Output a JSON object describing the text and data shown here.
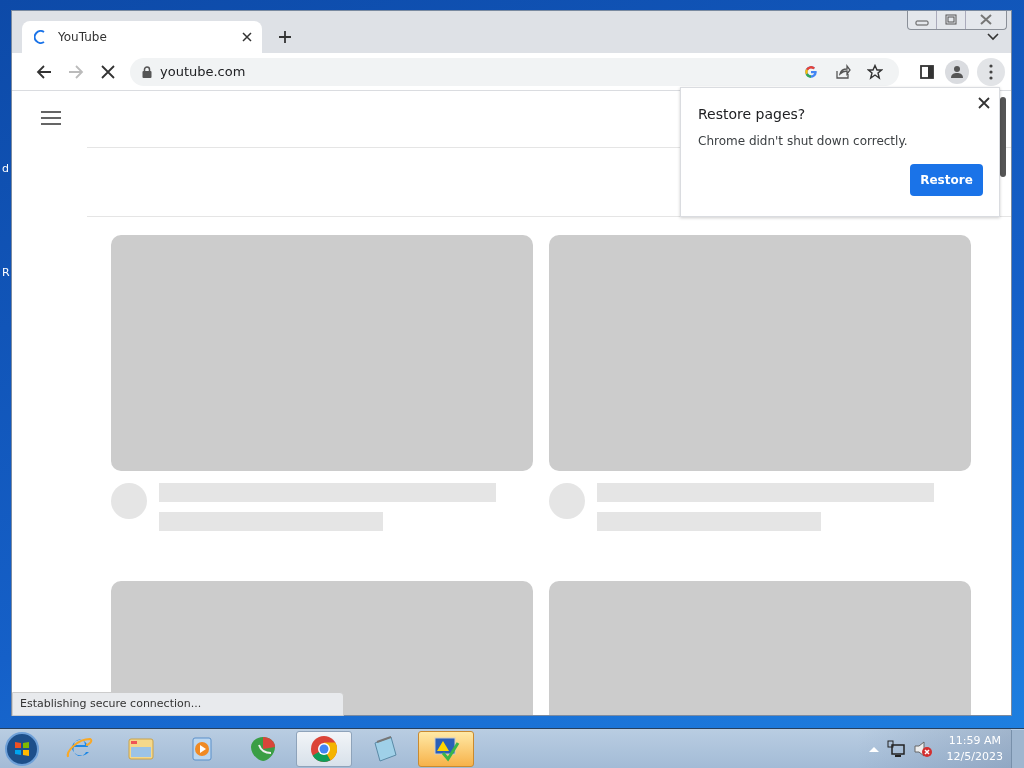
{
  "desktop": {
    "edge_labels": [
      "d",
      "R"
    ]
  },
  "browser": {
    "tabs": [
      {
        "title": "YouTube",
        "loading": true,
        "selected": true
      }
    ],
    "forward_disabled": true,
    "loading": true,
    "address": "youtube.com",
    "restore_popup": {
      "title": "Restore pages?",
      "message": "Chrome didn't shut down correctly.",
      "button": "Restore"
    },
    "status_bubble": "Establishing secure connection..."
  },
  "taskbar": {
    "apps": [
      {
        "kind": "ie",
        "open": false,
        "attention": false
      },
      {
        "kind": "explorer",
        "open": false,
        "attention": false
      },
      {
        "kind": "media",
        "open": false,
        "attention": false
      },
      {
        "kind": "shield",
        "open": false,
        "attention": false
      },
      {
        "kind": "chrome",
        "open": true,
        "attention": false
      },
      {
        "kind": "notepad",
        "open": false,
        "attention": false
      },
      {
        "kind": "action",
        "open": false,
        "attention": true
      }
    ],
    "clock": {
      "time": "11:59 AM",
      "date": "12/5/2023"
    }
  }
}
